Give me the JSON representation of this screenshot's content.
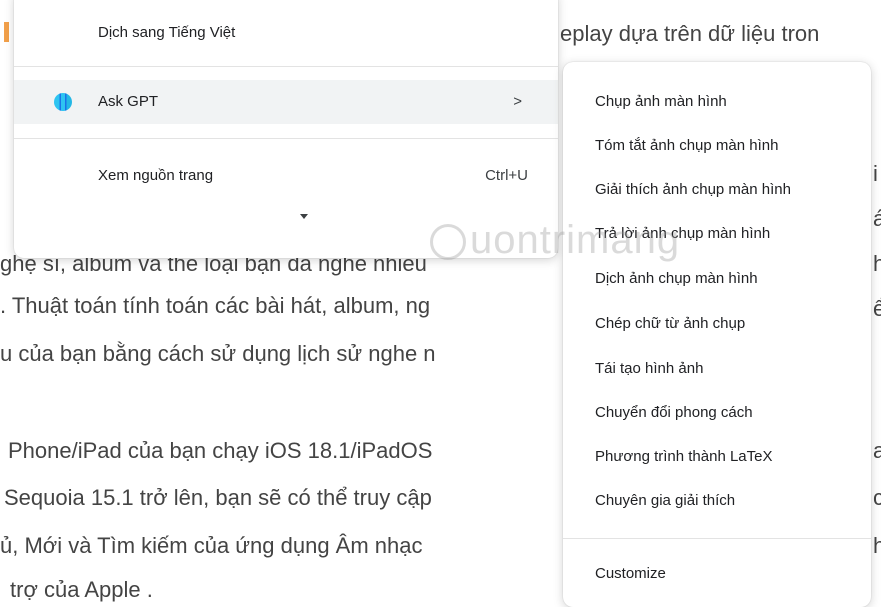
{
  "article": {
    "lines": [
      "eplay dựa trên dữ liệu tron",
      "ghệ sĩ, album và thể loại bạn đã nghe nhiều",
      ". Thuật toán tính toán các bài hát, album, ng",
      "u của bạn bằng cách sử dụng lịch sử nghe n",
      "Phone/iPad của bạn chạy iOS 18.1/iPadOS",
      "Sequoia 15.1 trở lên, bạn sẽ có thể truy cập",
      "ủ, Mới và Tìm kiếm của ứng dụng Âm nhạc",
      "trợ của Apple ."
    ],
    "right_letters": [
      "i",
      "á",
      "h",
      "ể",
      "a",
      "c",
      "h"
    ]
  },
  "watermark": {
    "text": "uontrimang"
  },
  "context_menu": {
    "translate_label": "Dịch sang Tiếng Việt",
    "ask_gpt_label": "Ask GPT",
    "ask_gpt_arrow": ">",
    "view_source_label": "Xem nguồn trang",
    "view_source_shortcut": "Ctrl+U"
  },
  "submenu": {
    "items": [
      "Chụp ảnh màn hình",
      "Tóm tắt ảnh chụp màn hình",
      "Giải thích ảnh chụp màn hình",
      "Trả lời ảnh chụp màn hình",
      "Dịch ảnh chụp màn hình",
      "Chép chữ từ ảnh chụp",
      "Tái tạo hình ảnh",
      "Chuyển đổi phong cách",
      "Phương trình thành LaTeX",
      "Chuyên gia giải thích"
    ],
    "customize_label": "Customize"
  },
  "colors": {
    "hover_bg": "#f1f3f4",
    "accent": "#f2a04a",
    "gpt_icon": "#2ec4f1"
  }
}
